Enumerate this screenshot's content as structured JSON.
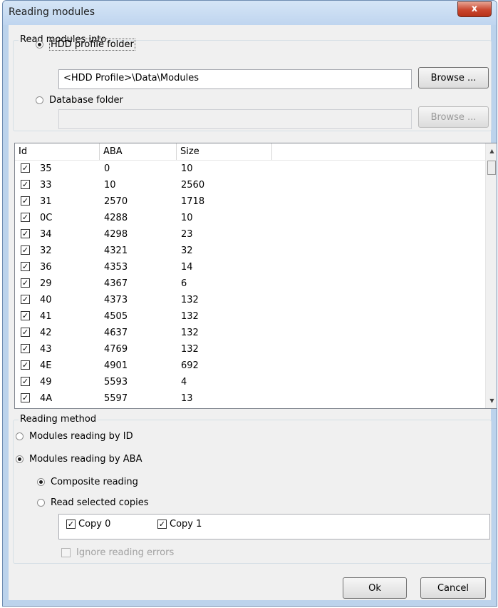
{
  "window": {
    "title": "Reading modules",
    "close_glyph": "x"
  },
  "read_into": {
    "legend": "Read modules into",
    "hdd_label": "HDD profile folder",
    "hdd_path": "<HDD Profile>\\Data\\Modules",
    "hdd_browse": "Browse ...",
    "db_label": "Database folder",
    "db_path": "",
    "db_browse": "Browse ..."
  },
  "table": {
    "columns": [
      "Id",
      "ABA",
      "Size"
    ],
    "rows": [
      {
        "id": "35",
        "aba": "0",
        "size": "10"
      },
      {
        "id": "33",
        "aba": "10",
        "size": "2560"
      },
      {
        "id": "31",
        "aba": "2570",
        "size": "1718"
      },
      {
        "id": "0C",
        "aba": "4288",
        "size": "10"
      },
      {
        "id": "34",
        "aba": "4298",
        "size": "23"
      },
      {
        "id": "32",
        "aba": "4321",
        "size": "32"
      },
      {
        "id": "36",
        "aba": "4353",
        "size": "14"
      },
      {
        "id": "29",
        "aba": "4367",
        "size": "6"
      },
      {
        "id": "40",
        "aba": "4373",
        "size": "132"
      },
      {
        "id": "41",
        "aba": "4505",
        "size": "132"
      },
      {
        "id": "42",
        "aba": "4637",
        "size": "132"
      },
      {
        "id": "43",
        "aba": "4769",
        "size": "132"
      },
      {
        "id": "4E",
        "aba": "4901",
        "size": "692"
      },
      {
        "id": "49",
        "aba": "5593",
        "size": "4"
      },
      {
        "id": "4A",
        "aba": "5597",
        "size": "13"
      }
    ]
  },
  "reading_method": {
    "legend": "Reading method",
    "by_id": "Modules reading by ID",
    "by_aba": "Modules reading by ABA",
    "composite": "Composite reading",
    "selected_copies": "Read selected copies",
    "copy0": "Copy 0",
    "copy1": "Copy 1",
    "ignore_errors": "Ignore reading errors"
  },
  "buttons": {
    "ok": "Ok",
    "cancel": "Cancel"
  },
  "colors": {
    "titlebar": "#bfd5ef",
    "close": "#c9462e",
    "dialog": "#f0f0f0"
  }
}
